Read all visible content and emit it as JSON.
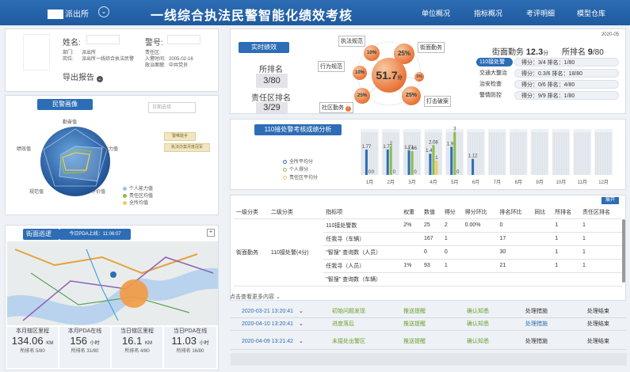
{
  "header": {
    "unit": "派出所",
    "title": "一线综合执法民警智能化绩效考核",
    "nav": [
      "单位概况",
      "指标概况",
      "考评明细",
      "模型仓库"
    ]
  },
  "profile": {
    "name_label": "姓名:",
    "badge_label": "警号:",
    "dept_label": "部门:",
    "dept_value": "派出所",
    "post_label": "岗位:",
    "post_value": "派出所一线综合执法民警",
    "duty_label": "责任区:",
    "duty_value": "",
    "join_label": "入警时间:",
    "join_value": "2005-02-16",
    "party_label": "政治面貌:",
    "party_value": "中共党员",
    "export": "导出报告"
  },
  "portrait": {
    "title": "民警画像",
    "date_placeholder": "日期选择",
    "axes": [
      "勤奋值",
      "能力值",
      "评价值",
      "规范值",
      "绩效值"
    ],
    "tags": [
      "警唯能手",
      "执法办案月度冠军"
    ],
    "legend": [
      "个人能力值",
      "责任区均值",
      "全所均值"
    ],
    "legend_colors": [
      "#9ec3e6",
      "#8bbd4b",
      "#f0c869"
    ]
  },
  "performance": {
    "title": "实时绩效",
    "rank_label": "所排名",
    "rank_value": "3/80",
    "zone_rank_label": "责任区排名",
    "zone_rank_value": "3/29",
    "total": "51.7",
    "total_unit": "分",
    "bubbles": [
      {
        "label": "执法规范",
        "value": "10%"
      },
      {
        "label": "街面勤务",
        "value": "25%"
      },
      {
        "label": "行为规范",
        "value": "10%"
      },
      {
        "label": "打击破案",
        "value": "25%"
      },
      {
        "label": "社区勤务",
        "value": "25%"
      },
      {
        "label": "",
        "value": "5%"
      }
    ],
    "date": "2020-05",
    "street_label": "街面勤务",
    "street_score": "12.3",
    "street_unit": "分",
    "street_rank_label": "所排名",
    "street_rank": "9",
    "street_rank_total": "/80",
    "items": [
      {
        "name": "110接处警",
        "text": "得分：3/4  排名：1/80"
      },
      {
        "name": "交通大整治",
        "text": "得分：0.3/6  排名：18/80"
      },
      {
        "name": "治安检查",
        "text": "得分：0/6  排名：4/80"
      },
      {
        "name": "警情防控",
        "text": "得分：9/9  排名：1/80"
      }
    ]
  },
  "chart_data": {
    "type": "bar",
    "title": "110接处警考核成绩分析",
    "categories": [
      "1月",
      "2月",
      "3月",
      "4月",
      "5月",
      "6月",
      "7月",
      "8月",
      "9月",
      "10月",
      "11月",
      "12月"
    ],
    "series": [
      {
        "name": "全所平均分",
        "values": [
          1.77,
          1.77,
          1.71,
          1.48,
          1.96,
          1.12,
          null,
          null,
          null,
          null,
          null,
          null
        ]
      },
      {
        "name": "个人得分",
        "values": [
          0,
          2,
          1.66,
          2.08,
          3,
          null,
          null,
          null,
          null,
          null,
          null,
          null
        ]
      },
      {
        "name": "责任区平均分",
        "values": [
          0,
          0,
          0,
          1.0,
          0,
          null,
          null,
          null,
          null,
          null,
          null,
          null
        ]
      }
    ],
    "legend": [
      "全所平均分",
      "个人得分",
      "责任区平均分"
    ],
    "colors": [
      "#2d6db5",
      "#8bbd4b",
      "#f0c869"
    ],
    "ylim": [
      0,
      3.2
    ],
    "value_labels": [
      "1.77",
      "1.71",
      "1.71",
      "1.66",
      "1.48",
      "1.96",
      "2.08",
      "3",
      "1.12"
    ]
  },
  "table": {
    "expand_label": "展开",
    "headers": [
      "一级分类",
      "二级分类",
      "指标项",
      "权重",
      "数值",
      "得分",
      "得分环比",
      "排名环比",
      "同比",
      "所排名",
      "责任区排名"
    ],
    "group1": "街面勤务",
    "group2": "110接处警(4分)",
    "rows": [
      [
        "110接处警数",
        "2%",
        "25",
        "2",
        "0.00%",
        "0",
        "",
        "1",
        "1"
      ],
      [
        "任我寻（车辆）",
        "",
        "167",
        "1",
        "",
        "17",
        "",
        "1",
        "1"
      ],
      [
        "\"智搜\" 查询数（人员）",
        "",
        "0",
        "0",
        "",
        "30",
        "",
        "1",
        "1"
      ],
      [
        "任我寻（人员）",
        "1%",
        "93",
        "1",
        "",
        "21",
        "",
        "1",
        "1"
      ],
      [
        "\"智搜\" 查询数（车辆）",
        "",
        "",
        "",
        "",
        "",
        "",
        "",
        ""
      ]
    ],
    "more": "点击查看更多内容"
  },
  "timeline": [
    {
      "time": "2020-03-21 13:20:41",
      "event": "初始问题发现",
      "push": "推送提醒",
      "confirm": "确认知悉",
      "handle": "处理措施",
      "end": "处理结束"
    },
    {
      "time": "2020-04-10 13:20:41",
      "event": "进度落后",
      "push": "推送提醒",
      "confirm": "确认知悉",
      "handle": "处理措施",
      "end": "处理结束"
    },
    {
      "time": "2020-04-09 13:21:42",
      "event": "未接处出警区",
      "push": "推送提醒",
      "confirm": "确认知悉",
      "handle": "处理措施",
      "end": "处理结束"
    }
  ],
  "patrol": {
    "title": "街面巡逻",
    "sub": "今日PDA上线：11:06:07",
    "stats": [
      {
        "title": "本月辖区里程",
        "value": "134.06",
        "unit": "KM",
        "rank": "所排名 5/80"
      },
      {
        "title": "本月PDA在线",
        "value": "156",
        "unit": "小时",
        "rank": "所排名 31/80"
      },
      {
        "title": "当日辖区里程",
        "value": "16.1",
        "unit": "KM",
        "rank": "所排名 4/80"
      },
      {
        "title": "当日PDA在线",
        "value": "11.03",
        "unit": "小时",
        "rank": "所排名 16/80"
      }
    ]
  }
}
